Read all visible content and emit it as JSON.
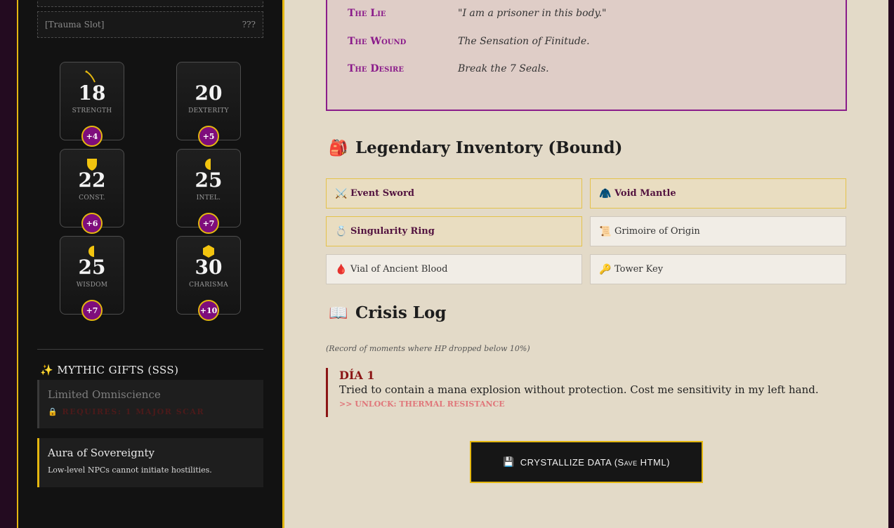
{
  "sidebar": {
    "trauma_slot": {
      "label": "[Trauma Slot]",
      "value": "???"
    },
    "stats": [
      {
        "value": "18",
        "label": "STRENGTH",
        "mod": "+4",
        "icon": "sword-slash-icon"
      },
      {
        "value": "20",
        "label": "DEXTERITY",
        "mod": "+5",
        "icon": ""
      },
      {
        "value": "22",
        "label": "CONST.",
        "mod": "+6",
        "icon": "shield-icon"
      },
      {
        "value": "25",
        "label": "INTEL.",
        "mod": "+7",
        "icon": "half-moon-icon"
      },
      {
        "value": "25",
        "label": "WISDOM",
        "mod": "+7",
        "icon": "half-moon-icon"
      },
      {
        "value": "30",
        "label": "CHARISMA",
        "mod": "+10",
        "icon": "hexagon-icon"
      }
    ],
    "gifts_heading": "MYTHIC GIFTS (SSS)",
    "gifts_heading_icon": "sparkles-icon",
    "gifts": [
      {
        "title": "Limited Omniscience",
        "lock_text": "REQUIRES: 1 MAJOR SCAR",
        "locked": true
      },
      {
        "title": "Aura of Sovereignty",
        "desc": "Low-level NPCs cannot initiate hostilities.",
        "locked": false
      }
    ]
  },
  "psych": {
    "rows": [
      {
        "label": "The Lie",
        "value": "\"I am a prisoner in this body.\""
      },
      {
        "label": "The Wound",
        "value": "The Sensation of Finitude."
      },
      {
        "label": "The Desire",
        "value": "Break the 7 Seals."
      }
    ]
  },
  "inventory": {
    "heading": "Legendary Inventory (Bound)",
    "heading_icon": "backpack-icon",
    "items": [
      {
        "name": "Event Sword",
        "icon": "crossed-swords-icon",
        "glyph": "⚔️",
        "legendary": true
      },
      {
        "name": "Void Mantle",
        "icon": "mantle-icon",
        "glyph": "🧥",
        "legendary": true
      },
      {
        "name": "Singularity Ring",
        "icon": "ring-icon",
        "glyph": "💍",
        "legendary": true
      },
      {
        "name": "Grimoire of Origin",
        "icon": "scroll-icon",
        "glyph": "📜",
        "legendary": false
      },
      {
        "name": "Vial of Ancient Blood",
        "icon": "blood-drop-icon",
        "glyph": "🩸",
        "legendary": false
      },
      {
        "name": "Tower Key",
        "icon": "key-icon",
        "glyph": "🔑",
        "legendary": false
      }
    ]
  },
  "crisis": {
    "heading": "Crisis Log",
    "heading_icon": "open-book-icon",
    "note": "(Record of moments where HP dropped below 10%)",
    "entries": [
      {
        "day": "DÍA 1",
        "text": "Tried to contain a mana explosion without protection. Cost me sensitivity in my left hand.",
        "unlock": ">> UNLOCK: THERMAL RESISTANCE"
      }
    ]
  },
  "save_button": {
    "label": "CRYSTALLIZE DATA (Save HTML)",
    "icon": "floppy-disk-icon"
  },
  "colors": {
    "gold": "#e4b710",
    "purple": "#7e0d7c",
    "parchment": "#e3dac8",
    "crimson": "#8b1414"
  }
}
